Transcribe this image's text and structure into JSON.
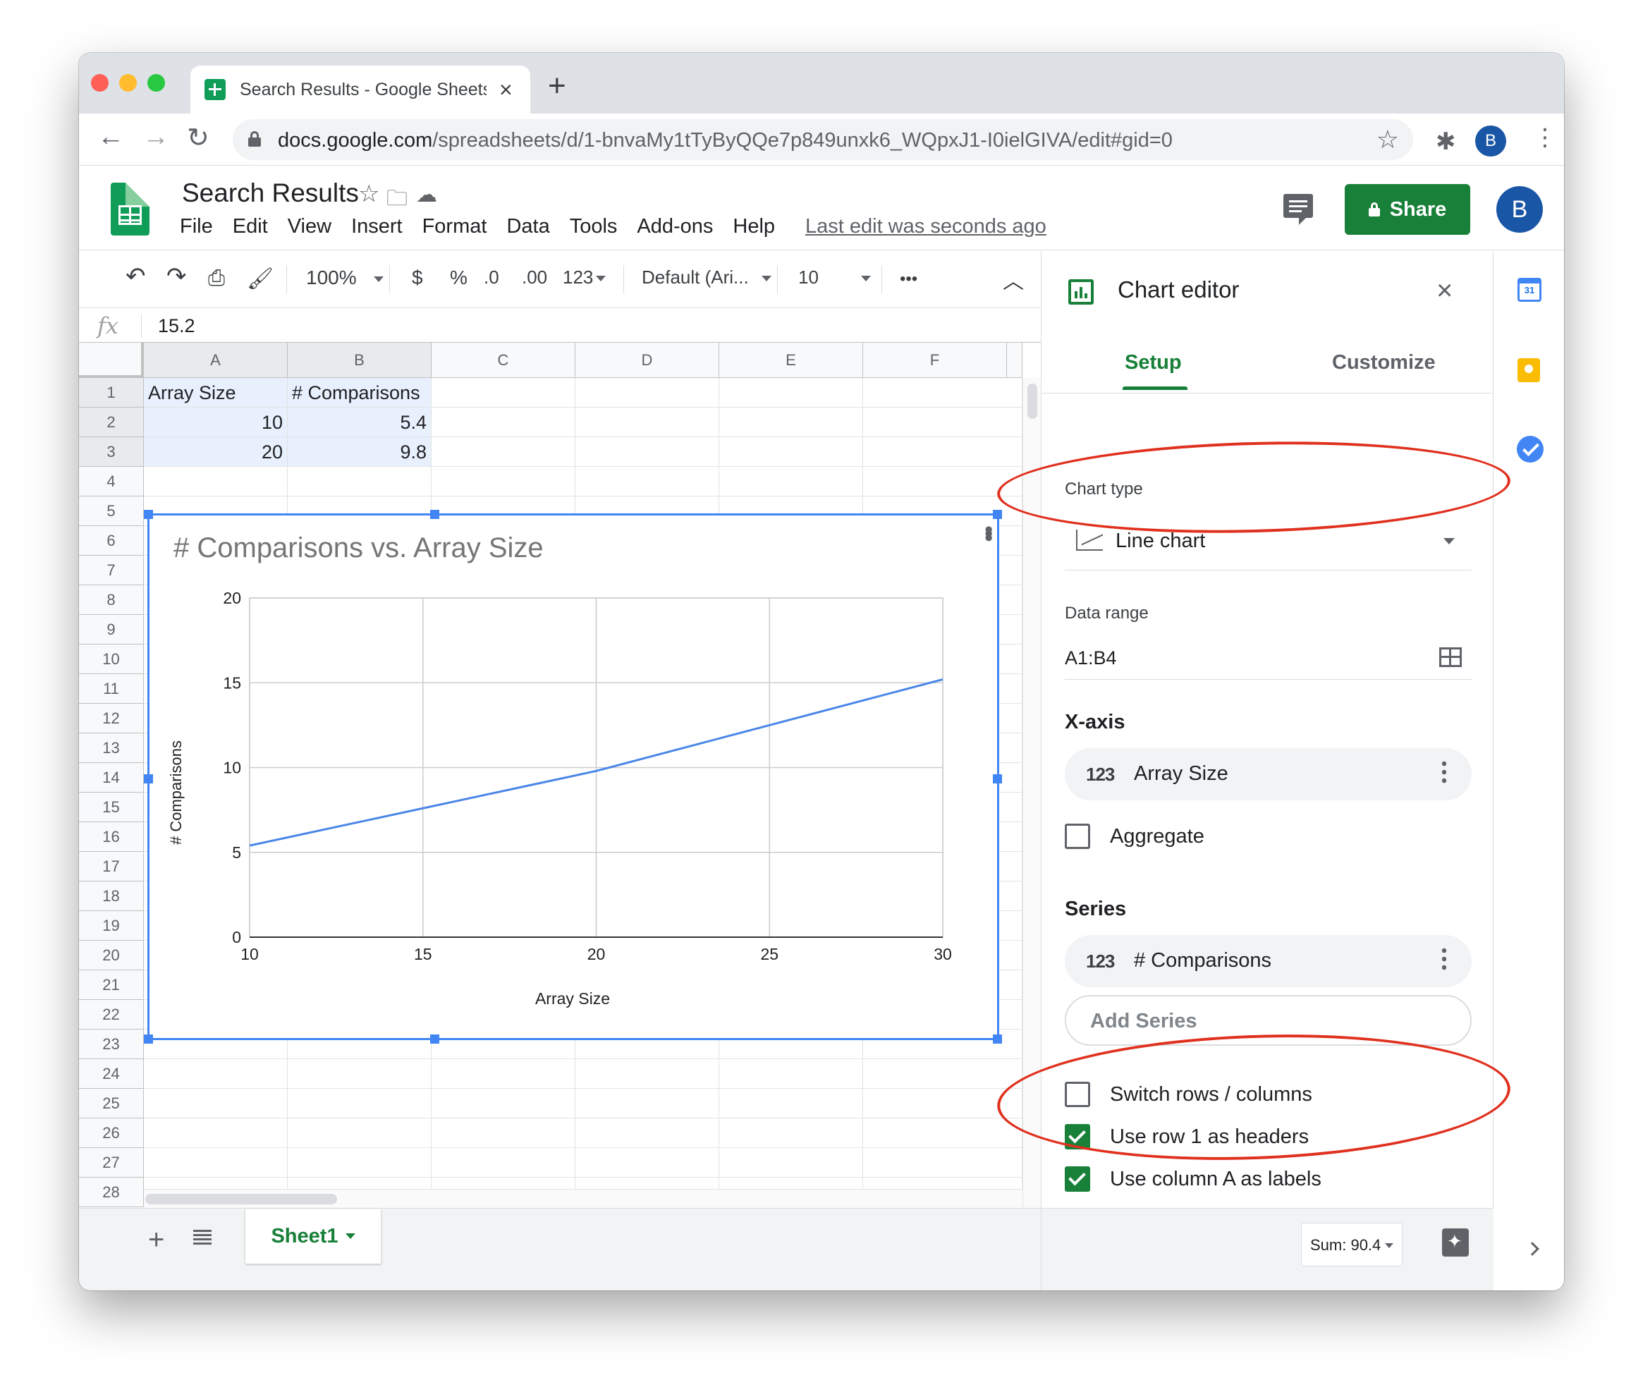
{
  "browser": {
    "tab_title": "Search Results - Google Sheets",
    "url_host": "docs.google.com",
    "url_path": "/spreadsheets/d/1-bnvaMy1tTyByQQe7p849unxk6_WQpxJ1-I0ielGIVA/edit#gid=0",
    "profile_initial": "B"
  },
  "app": {
    "doc_title": "Search Results",
    "menu": [
      "File",
      "Edit",
      "View",
      "Insert",
      "Format",
      "Data",
      "Tools",
      "Add-ons",
      "Help"
    ],
    "last_edit": "Last edit was seconds ago",
    "share_label": "Share",
    "profile_initial": "B",
    "accent_color": "#188038"
  },
  "toolbar": {
    "zoom": "100%",
    "currency": "$",
    "percent": "%",
    "decrease_decimals": ".0",
    "increase_decimals": ".00",
    "more_formats": "123",
    "font": "Default (Ari...",
    "font_size": "10",
    "more": "•••"
  },
  "formula": {
    "fx": "fx",
    "value": "15.2"
  },
  "grid": {
    "columns": [
      "A",
      "B",
      "C",
      "D",
      "E",
      "F"
    ],
    "rows": [
      "1",
      "2",
      "3",
      "4",
      "5",
      "6",
      "7",
      "8",
      "9",
      "10",
      "11",
      "12",
      "13",
      "14",
      "15",
      "16",
      "17",
      "18",
      "19",
      "20",
      "21",
      "22",
      "23",
      "24",
      "25",
      "26",
      "27",
      "28"
    ],
    "cells": {
      "a1": "Array Size",
      "b1": "# Comparisons",
      "a2": "10",
      "b2": "5.4",
      "a3": "20",
      "b3": "9.8"
    }
  },
  "chart_data": {
    "type": "line",
    "title": "# Comparisons vs. Array Size",
    "xlabel": "Array Size",
    "ylabel": "# Comparisons",
    "x": [
      10,
      20,
      30
    ],
    "series": [
      {
        "name": "# Comparisons",
        "values": [
          5.4,
          9.8,
          15.2
        ],
        "color": "#4a86e8"
      }
    ],
    "xlim": [
      10,
      30
    ],
    "ylim": [
      0,
      20
    ],
    "xticks": [
      10,
      15,
      20,
      25,
      30
    ],
    "yticks": [
      0,
      5,
      10,
      15,
      20
    ],
    "grid": true,
    "legend": "none"
  },
  "sheetbar": {
    "plus": "+",
    "tab_name": "Sheet1"
  },
  "editor": {
    "title": "Chart editor",
    "tab_setup": "Setup",
    "tab_customize": "Customize",
    "chart_type_label": "Chart type",
    "chart_type_value": "Line chart",
    "data_range_label": "Data range",
    "data_range_value": "A1:B4",
    "x_axis_heading": "X-axis",
    "x_axis_value": "Array Size",
    "aggregate_label": "Aggregate",
    "series_heading": "Series",
    "series_value": "# Comparisons",
    "type_badge": "123",
    "add_series": "Add Series",
    "switch_rows_label": "Switch rows / columns",
    "use_row1_label": "Use row 1 as headers",
    "use_colA_label": "Use column A as labels",
    "aggregate_checked": false,
    "switch_rows_checked": false,
    "use_row1_checked": true,
    "use_colA_checked": true,
    "sum": "Sum: 90.4"
  },
  "sidepanel": {
    "calendar_day": "31"
  },
  "annotation_color": "#e0301e"
}
